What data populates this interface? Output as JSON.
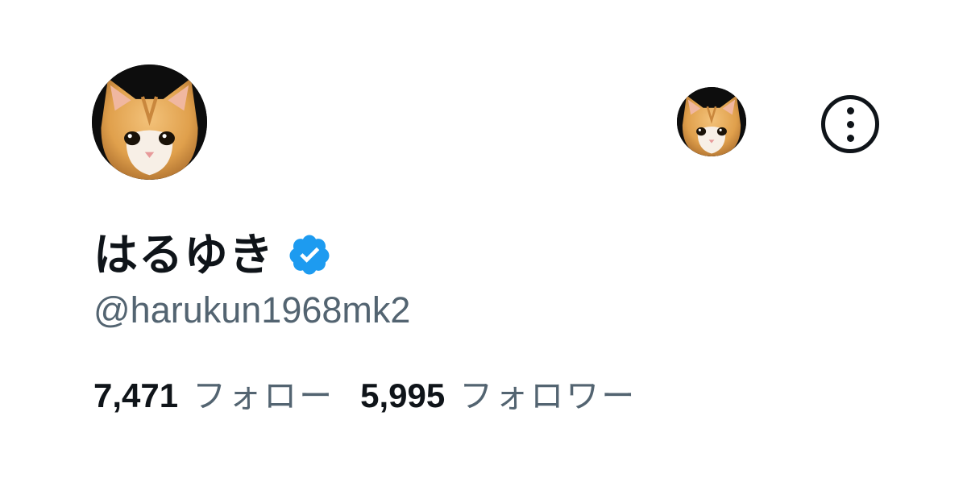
{
  "profile": {
    "display_name": "はるゆき",
    "handle": "@harukun1968mk2",
    "verified": true
  },
  "stats": {
    "following_count": "7,471",
    "following_label": "フォロー",
    "followers_count": "5,995",
    "followers_label": "フォロワー"
  },
  "icons": {
    "avatar": "kitten-avatar",
    "small_avatar": "kitten-avatar",
    "more": "more-options-icon",
    "verified": "verified-badge-icon"
  },
  "colors": {
    "text_primary": "#0f1419",
    "text_secondary": "#536471",
    "verified_blue": "#1d9bf0",
    "background": "#ffffff"
  }
}
